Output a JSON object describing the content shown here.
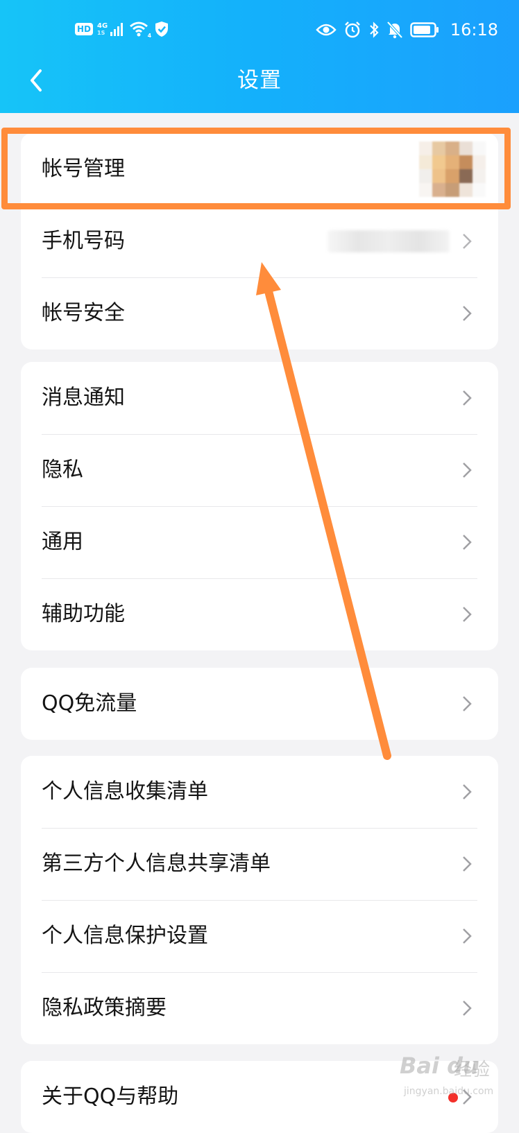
{
  "status_bar": {
    "hd": "HD",
    "network": "4G",
    "network_sub": "1S",
    "wifi_sub": "4",
    "time": "16:18"
  },
  "header": {
    "title": "设置",
    "bg_color": "#16b6fa"
  },
  "groups": [
    {
      "rows": [
        {
          "label": "帐号管理"
        },
        {
          "label": "手机号码"
        },
        {
          "label": "帐号安全"
        }
      ]
    },
    {
      "rows": [
        {
          "label": "消息通知"
        },
        {
          "label": "隐私"
        },
        {
          "label": "通用"
        },
        {
          "label": "辅助功能"
        }
      ]
    },
    {
      "rows": [
        {
          "label": "QQ免流量"
        }
      ]
    },
    {
      "rows": [
        {
          "label": "个人信息收集清单"
        },
        {
          "label": "第三方个人信息共享清单"
        },
        {
          "label": "个人信息保护设置"
        },
        {
          "label": "隐私政策摘要"
        }
      ]
    },
    {
      "rows": [
        {
          "label": "关于QQ与帮助"
        }
      ]
    }
  ],
  "annotation": {
    "color": "#ff8c3b"
  },
  "watermark": {
    "logo": "Bai du",
    "brand": "经验",
    "url": "jingyan.baidu.com"
  }
}
